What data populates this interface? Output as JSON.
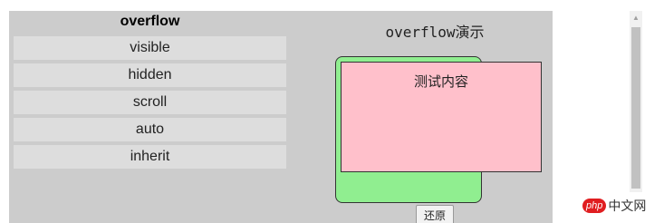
{
  "menu": {
    "title": "overflow",
    "items": [
      {
        "label": "visible"
      },
      {
        "label": "hidden"
      },
      {
        "label": "scroll"
      },
      {
        "label": "auto"
      },
      {
        "label": "inherit"
      }
    ]
  },
  "demo": {
    "title": "overflow演示",
    "content": "测试内容",
    "reset_label": "还原"
  },
  "watermark": {
    "logo": "php",
    "site": "中文网"
  },
  "colors": {
    "stage_bg": "#cccccc",
    "menu_item_bg": "#dddddd",
    "green_box": "#90ee90",
    "pink_box": "#ffc0cb"
  }
}
